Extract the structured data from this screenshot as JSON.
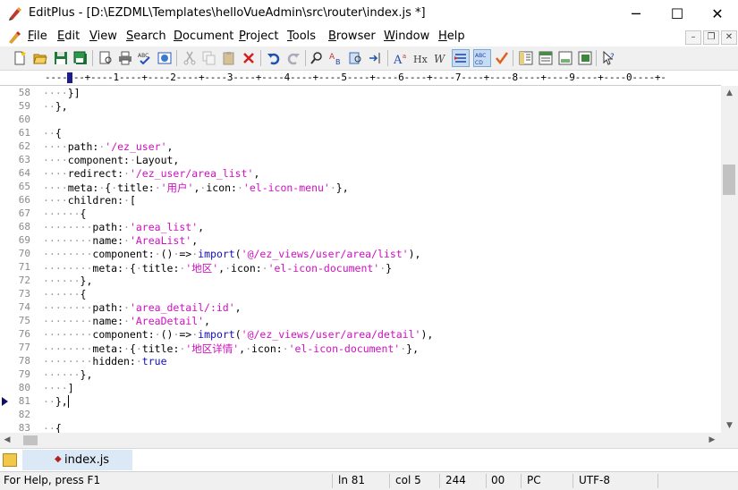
{
  "window": {
    "title": "EditPlus - [D:\\EZDML\\Templates\\helloVueAdmin\\src\\router\\index.js *]",
    "minimize_glyph": "─",
    "maximize_glyph": "☐",
    "close_glyph": "✕"
  },
  "menu": {
    "items": [
      {
        "accel": "F",
        "rest": "ile"
      },
      {
        "accel": "E",
        "rest": "dit"
      },
      {
        "accel": "V",
        "rest": "iew"
      },
      {
        "accel": "S",
        "rest": "earch"
      },
      {
        "accel": "D",
        "rest": "ocument"
      },
      {
        "accel": "P",
        "rest": "roject"
      },
      {
        "accel": "T",
        "rest": "ools"
      },
      {
        "accel": "B",
        "rest": "rowser"
      },
      {
        "accel": "W",
        "rest": "indow"
      },
      {
        "accel": "H",
        "rest": "elp"
      }
    ],
    "mdi_min": "–",
    "mdi_restore": "❐",
    "mdi_close": "✕"
  },
  "toolbar": {
    "icons": [
      "new-file-icon",
      "open-folder-icon",
      "save-icon",
      "save-all-icon",
      "print-preview-icon",
      "print-icon",
      "spell-check-icon",
      "browser-view-icon",
      "cut-icon",
      "copy-icon",
      "paste-icon",
      "delete-icon",
      "undo-icon",
      "redo-icon",
      "find-icon",
      "replace-icon",
      "find-in-files-icon",
      "goto-icon",
      "font-icon",
      "html-heading-icon",
      "word-wrap-icon",
      "line-marker-icon",
      "spell-abc-icon",
      "checkmark-icon",
      "cliptext-icon",
      "directory-icon",
      "output-window-icon",
      "template-icon",
      "help-cursor-icon"
    ]
  },
  "ruler": {
    "text": "-------+----1----+----2----+----3----+----4----+----5----+----6----+----7----+----8----+----9----+----0----+-"
  },
  "editor": {
    "lines": [
      {
        "n": "58",
        "ws": "····",
        "code": [
          {
            "t": "}]",
            "c": ""
          }
        ]
      },
      {
        "n": "59",
        "ws": "··",
        "code": [
          {
            "t": "},",
            "c": ""
          }
        ]
      },
      {
        "n": "60",
        "ws": "",
        "code": []
      },
      {
        "n": "61",
        "ws": "··",
        "code": [
          {
            "t": "{",
            "c": ""
          }
        ]
      },
      {
        "n": "62",
        "ws": "····",
        "code": [
          {
            "t": "path: ",
            "c": ""
          },
          {
            "t": "'/ez_user'",
            "c": "str"
          },
          {
            "t": ",",
            "c": ""
          }
        ]
      },
      {
        "n": "63",
        "ws": "····",
        "code": [
          {
            "t": "component: Layout,",
            "c": ""
          }
        ]
      },
      {
        "n": "64",
        "ws": "····",
        "code": [
          {
            "t": "redirect: ",
            "c": ""
          },
          {
            "t": "'/ez_user/area_list'",
            "c": "str"
          },
          {
            "t": ",",
            "c": ""
          }
        ]
      },
      {
        "n": "65",
        "ws": "····",
        "code": [
          {
            "t": "meta: { title: ",
            "c": ""
          },
          {
            "t": "'用户'",
            "c": "str"
          },
          {
            "t": ", icon: ",
            "c": ""
          },
          {
            "t": "'el-icon-menu'",
            "c": "str"
          },
          {
            "t": " },",
            "c": ""
          }
        ]
      },
      {
        "n": "66",
        "ws": "····",
        "code": [
          {
            "t": "children: [",
            "c": ""
          }
        ]
      },
      {
        "n": "67",
        "ws": "······",
        "code": [
          {
            "t": "{",
            "c": ""
          }
        ]
      },
      {
        "n": "68",
        "ws": "········",
        "code": [
          {
            "t": "path: ",
            "c": ""
          },
          {
            "t": "'area_list'",
            "c": "str"
          },
          {
            "t": ",",
            "c": ""
          }
        ]
      },
      {
        "n": "69",
        "ws": "········",
        "code": [
          {
            "t": "name: ",
            "c": ""
          },
          {
            "t": "'AreaList'",
            "c": "str"
          },
          {
            "t": ",",
            "c": ""
          }
        ]
      },
      {
        "n": "70",
        "ws": "········",
        "code": [
          {
            "t": "component: () => ",
            "c": ""
          },
          {
            "t": "import",
            "c": "kw"
          },
          {
            "t": "(",
            "c": ""
          },
          {
            "t": "'@/ez_views/user/area/list'",
            "c": "str"
          },
          {
            "t": "),",
            "c": ""
          }
        ]
      },
      {
        "n": "71",
        "ws": "········",
        "code": [
          {
            "t": "meta: { title: ",
            "c": ""
          },
          {
            "t": "'地区'",
            "c": "str"
          },
          {
            "t": ", icon: ",
            "c": ""
          },
          {
            "t": "'el-icon-document'",
            "c": "str"
          },
          {
            "t": " }",
            "c": ""
          }
        ]
      },
      {
        "n": "72",
        "ws": "······",
        "code": [
          {
            "t": "},",
            "c": ""
          }
        ]
      },
      {
        "n": "73",
        "ws": "······",
        "code": [
          {
            "t": "{",
            "c": ""
          }
        ]
      },
      {
        "n": "74",
        "ws": "········",
        "code": [
          {
            "t": "path: ",
            "c": ""
          },
          {
            "t": "'area_detail/:id'",
            "c": "str"
          },
          {
            "t": ",",
            "c": ""
          }
        ]
      },
      {
        "n": "75",
        "ws": "········",
        "code": [
          {
            "t": "name: ",
            "c": ""
          },
          {
            "t": "'AreaDetail'",
            "c": "str"
          },
          {
            "t": ",",
            "c": ""
          }
        ]
      },
      {
        "n": "76",
        "ws": "········",
        "code": [
          {
            "t": "component: () => ",
            "c": ""
          },
          {
            "t": "import",
            "c": "kw"
          },
          {
            "t": "(",
            "c": ""
          },
          {
            "t": "'@/ez_views/user/area/detail'",
            "c": "str"
          },
          {
            "t": "),",
            "c": ""
          }
        ]
      },
      {
        "n": "77",
        "ws": "········",
        "code": [
          {
            "t": "meta: { title: ",
            "c": ""
          },
          {
            "t": "'地区详情'",
            "c": "str"
          },
          {
            "t": ", icon: ",
            "c": ""
          },
          {
            "t": "'el-icon-document'",
            "c": "str"
          },
          {
            "t": " },",
            "c": ""
          }
        ]
      },
      {
        "n": "78",
        "ws": "········",
        "code": [
          {
            "t": "hidden: ",
            "c": ""
          },
          {
            "t": "true",
            "c": "kw"
          }
        ]
      },
      {
        "n": "79",
        "ws": "······",
        "code": [
          {
            "t": "},",
            "c": ""
          }
        ]
      },
      {
        "n": "80",
        "ws": "····",
        "code": [
          {
            "t": "]",
            "c": ""
          }
        ]
      },
      {
        "n": "81",
        "ws": "··",
        "code": [
          {
            "t": "},",
            "c": ""
          }
        ],
        "cursor": true,
        "marker": true
      },
      {
        "n": "82",
        "ws": "",
        "code": []
      },
      {
        "n": "83",
        "ws": "··",
        "code": [
          {
            "t": "{",
            "c": ""
          }
        ]
      }
    ]
  },
  "tabs": {
    "active": "index.js",
    "modified_glyph": "◆"
  },
  "status": {
    "help": "For Help, press F1",
    "line": "ln 81",
    "col": "col 5",
    "count": "244",
    "chars": "00",
    "eol": "PC",
    "encoding": "UTF-8"
  },
  "colors": {
    "string": "#d010c0",
    "keyword": "#1010c0",
    "whitespace_dots": "#9b9b9b"
  }
}
